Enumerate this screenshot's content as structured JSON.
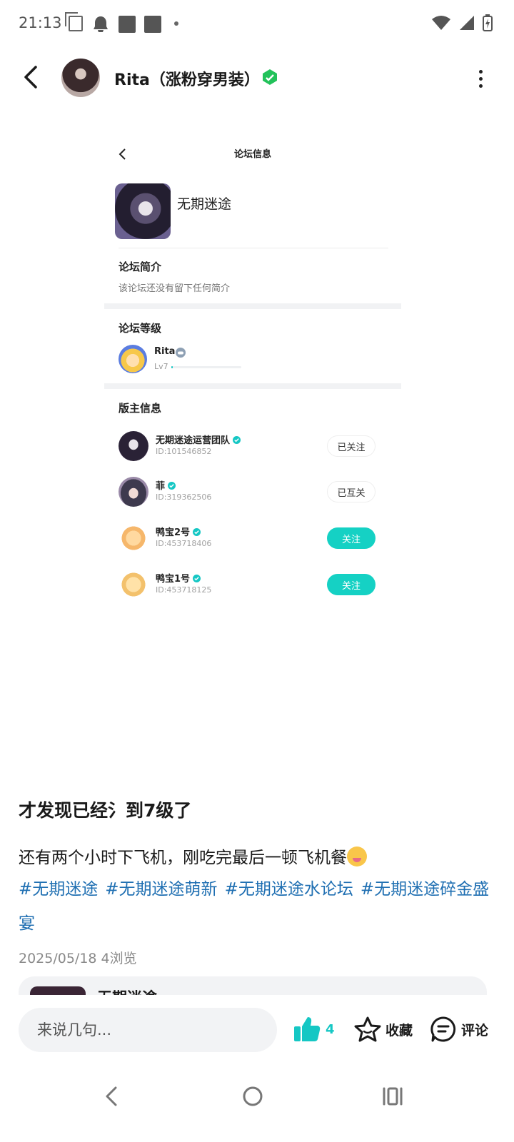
{
  "status_bar": {
    "time": "21:13"
  },
  "header": {
    "title": "Rita（涨粉穿男装）"
  },
  "embedded_screenshot": {
    "title": "论坛信息",
    "forum_name": "无期迷途",
    "intro_heading": "论坛简介",
    "intro_text": "该论坛还没有留下任何简介",
    "level_heading": "论坛等级",
    "level_user": {
      "name": "Rita",
      "level": "Lv7",
      "progress_fraction": 0.02
    },
    "mods_heading": "版主信息",
    "moderators": [
      {
        "name": "无期迷途运营团队",
        "id": "ID:101546852",
        "button": "已关注",
        "following": true
      },
      {
        "name": "菲",
        "id": "ID:319362506",
        "button": "已互关",
        "following": true
      },
      {
        "name": "鸭宝2号",
        "id": "ID:453718406",
        "button": "关注",
        "following": false
      },
      {
        "name": "鸭宝1号",
        "id": "ID:453718125",
        "button": "关注",
        "following": false
      }
    ]
  },
  "post": {
    "title": "才发现已经氵到7级了",
    "body": "还有两个小时下飞机，刚吃完最后一顿飞机餐",
    "tags": [
      "#无期迷途",
      "#无期迷途萌新",
      "#无期迷途水论坛",
      "#无期迷途碎金盛宴"
    ],
    "date_views": "2025/05/18  4浏览"
  },
  "card": {
    "name": "无期迷途"
  },
  "action_bar": {
    "comment_placeholder": "来说几句...",
    "like_count": "4",
    "favorite_label": "收藏",
    "comment_label": "评论"
  },
  "colors": {
    "accent": "#15c7c4",
    "tag": "#1f6fb2",
    "vip_badge": "#22c25a"
  }
}
